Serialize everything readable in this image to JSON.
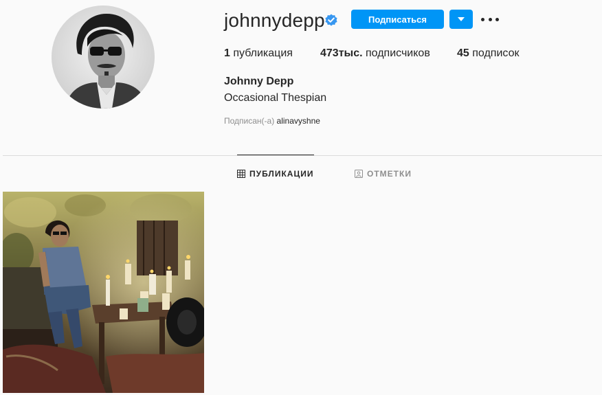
{
  "profile": {
    "username": "johnnydepp",
    "verified": true,
    "full_name": "Johnny Depp",
    "bio": "Occasional Thespian",
    "followed_by_label": "Подписан(-а)",
    "followed_by_user": "alinavyshne"
  },
  "actions": {
    "follow_label": "Подписаться",
    "dropdown_icon": "triangle-down-icon",
    "more_icon": "ellipsis-icon"
  },
  "stats": {
    "posts_count": "1",
    "posts_label": "публикация",
    "followers_count": "473тыс.",
    "followers_label": "подписчиков",
    "following_count": "45",
    "following_label": "подписок"
  },
  "tabs": {
    "posts_label": "ПУБЛИКАЦИИ",
    "tagged_label": "ОТМЕТКИ",
    "active": "posts"
  },
  "colors": {
    "accent": "#0095f6",
    "text": "#262626",
    "muted": "#8e8e8e",
    "background": "#fafafa",
    "divider": "#dbdbdb"
  }
}
